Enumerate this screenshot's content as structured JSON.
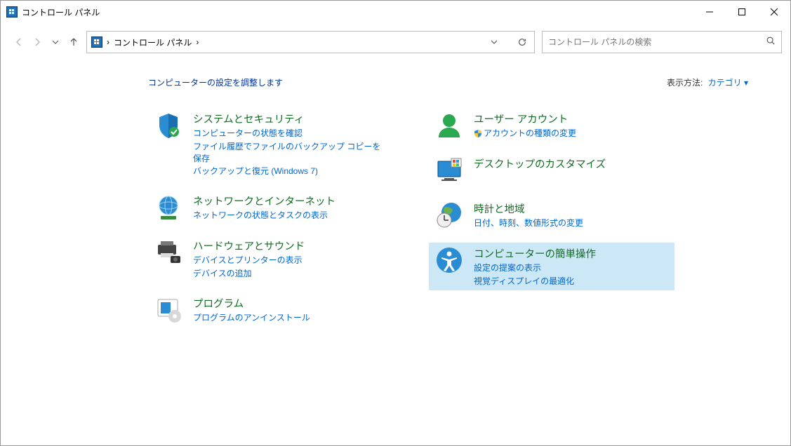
{
  "window": {
    "title": "コントロール パネル"
  },
  "breadcrumb": {
    "root": "コントロール パネル"
  },
  "search": {
    "placeholder": "コントロール パネルの検索"
  },
  "heading": "コンピューターの設定を調整します",
  "viewby": {
    "label": "表示方法:",
    "value": "カテゴリ"
  },
  "left": [
    {
      "title": "システムとセキュリティ",
      "links": [
        "コンピューターの状態を確認",
        "ファイル履歴でファイルのバックアップ コピーを保存",
        "バックアップと復元 (Windows 7)"
      ]
    },
    {
      "title": "ネットワークとインターネット",
      "links": [
        "ネットワークの状態とタスクの表示"
      ]
    },
    {
      "title": "ハードウェアとサウンド",
      "links": [
        "デバイスとプリンターの表示",
        "デバイスの追加"
      ]
    },
    {
      "title": "プログラム",
      "links": [
        "プログラムのアンインストール"
      ]
    }
  ],
  "right": [
    {
      "title": "ユーザー アカウント",
      "links": [
        "アカウントの種類の変更"
      ],
      "shield": true
    },
    {
      "title": "デスクトップのカスタマイズ",
      "links": []
    },
    {
      "title": "時計と地域",
      "links": [
        "日付、時刻、数値形式の変更"
      ]
    },
    {
      "title": "コンピューターの簡単操作",
      "links": [
        "設定の提案の表示",
        "視覚ディスプレイの最適化"
      ],
      "highlight": true
    }
  ]
}
